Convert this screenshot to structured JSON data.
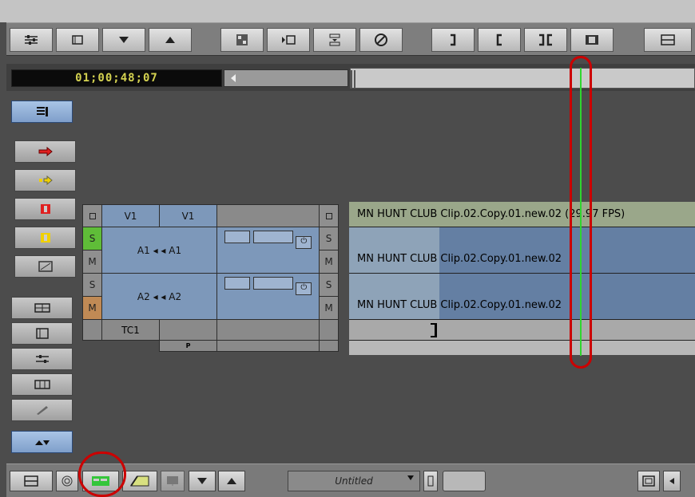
{
  "timecode": "01;00;48;07",
  "tracks": {
    "video": {
      "source": "V1",
      "record": "V1"
    },
    "audio": [
      {
        "source": "A1",
        "record": "A1",
        "solo": "S",
        "mute": "M"
      },
      {
        "source": "A2",
        "record": "A2",
        "solo": "S",
        "mute": "M"
      }
    ],
    "timecode_track": "TC1",
    "patch_marker": "P"
  },
  "sequence": {
    "title_clip": "MN HUNT CLUB Clip.02.Copy.01.new.02 (29.97 FPS)",
    "a1_clip": "MN HUNT CLUB Clip.02.Copy.01.new.02",
    "a2_clip": "MN HUNT CLUB Clip.02.Copy.01.new.02"
  },
  "bottom": {
    "bin_name": "Untitled"
  },
  "colors": {
    "accent_blue": "#7d98ba",
    "highlight_red": "#c00000",
    "position_indicator": "#2fd62f",
    "timecode_text": "#d4d250"
  },
  "icons": [
    "settings-sliders-icon",
    "clip-icon",
    "down-arrow-icon",
    "up-arrow-icon",
    "effect-icon",
    "mark-clip-icon",
    "lift-icon",
    "clear-icon",
    "mark-out-icon",
    "mark-in-icon",
    "trim-icon",
    "segment-icon",
    "stack-icon"
  ]
}
